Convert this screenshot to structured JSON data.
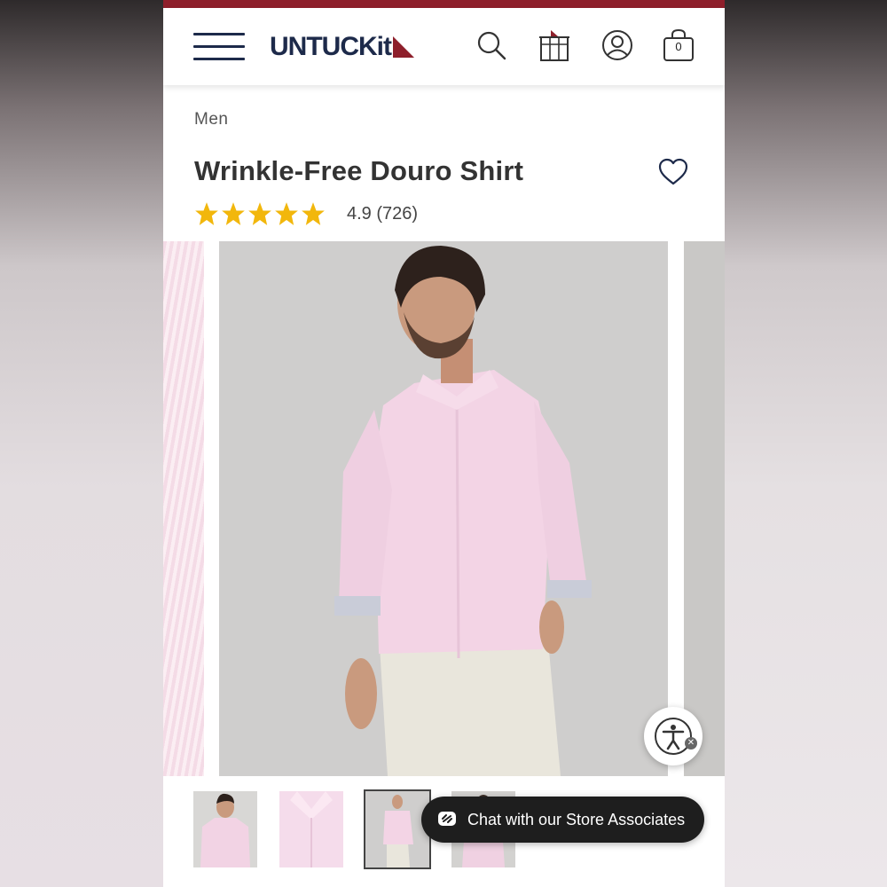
{
  "brand": {
    "logo_text": "UNTUCKit",
    "accent": "#8e1f2b",
    "navy": "#1d2a4a"
  },
  "header": {
    "icons": [
      "menu-icon",
      "search-icon",
      "store-icon",
      "account-icon",
      "cart-icon"
    ],
    "cart_count": "0"
  },
  "breadcrumb": "Men",
  "product": {
    "title": "Wrinkle-Free Douro Shirt",
    "rating_value": "4.9",
    "review_count": "(726)",
    "stars": 5,
    "star_color": "#f2b70c"
  },
  "gallery": {
    "images": [
      "pink shirt fabric close-up",
      "model wearing pink shirt",
      "gray background"
    ],
    "thumbnails": [
      "model front",
      "collar detail",
      "full body",
      "back view"
    ],
    "selected_thumbnail": 3
  },
  "chat": {
    "label": "Chat with our Store Associates"
  }
}
